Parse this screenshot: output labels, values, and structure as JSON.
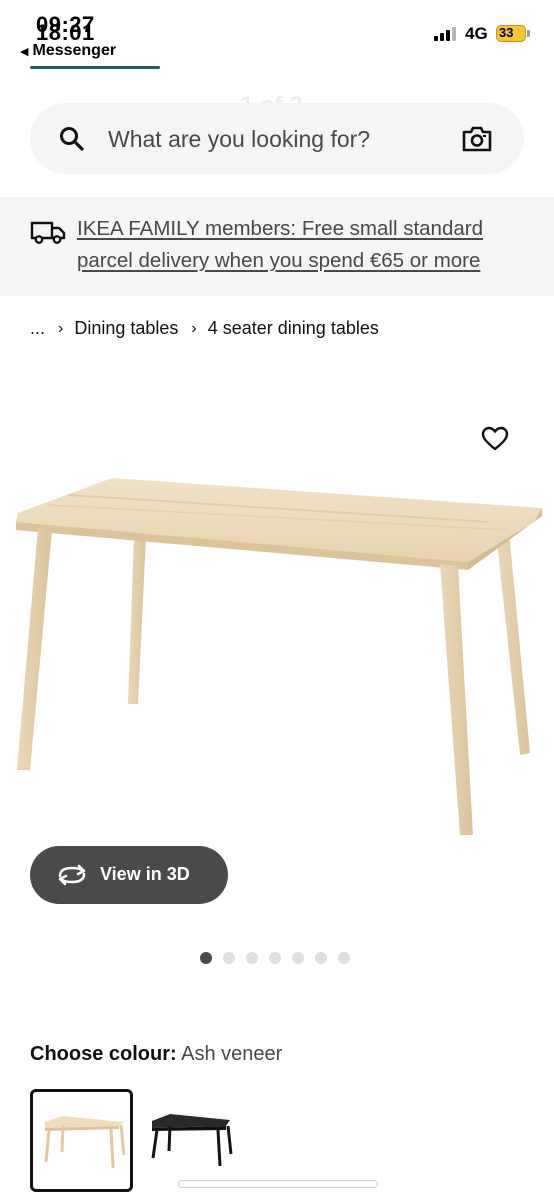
{
  "status_bar": {
    "time_top": "09:27",
    "time_bottom": "18:01",
    "back_app": "Messenger",
    "network": "4G",
    "battery_label": "33"
  },
  "header": {
    "ghost_counter": "1 of 2"
  },
  "search": {
    "placeholder": "What are you looking for?"
  },
  "promo": {
    "text": "IKEA FAMILY members: Free small standard parcel delivery when you spend €65 or more"
  },
  "breadcrumb": {
    "ellipsis": "...",
    "items": [
      "Dining tables",
      "4 seater dining tables"
    ]
  },
  "gallery": {
    "view_3d_label": "View in 3D",
    "page_count": 7,
    "current_page": 1
  },
  "colour": {
    "label": "Choose colour:",
    "value": "Ash veneer",
    "options": [
      {
        "name": "Ash veneer",
        "selected": true,
        "color": "#ead8b8"
      },
      {
        "name": "Black",
        "selected": false,
        "color": "#1c1c1c"
      }
    ]
  },
  "colors": {
    "promo_background": "#f5f5f5",
    "button_dark": "#4a4a4a",
    "battery": "#f6c437"
  }
}
